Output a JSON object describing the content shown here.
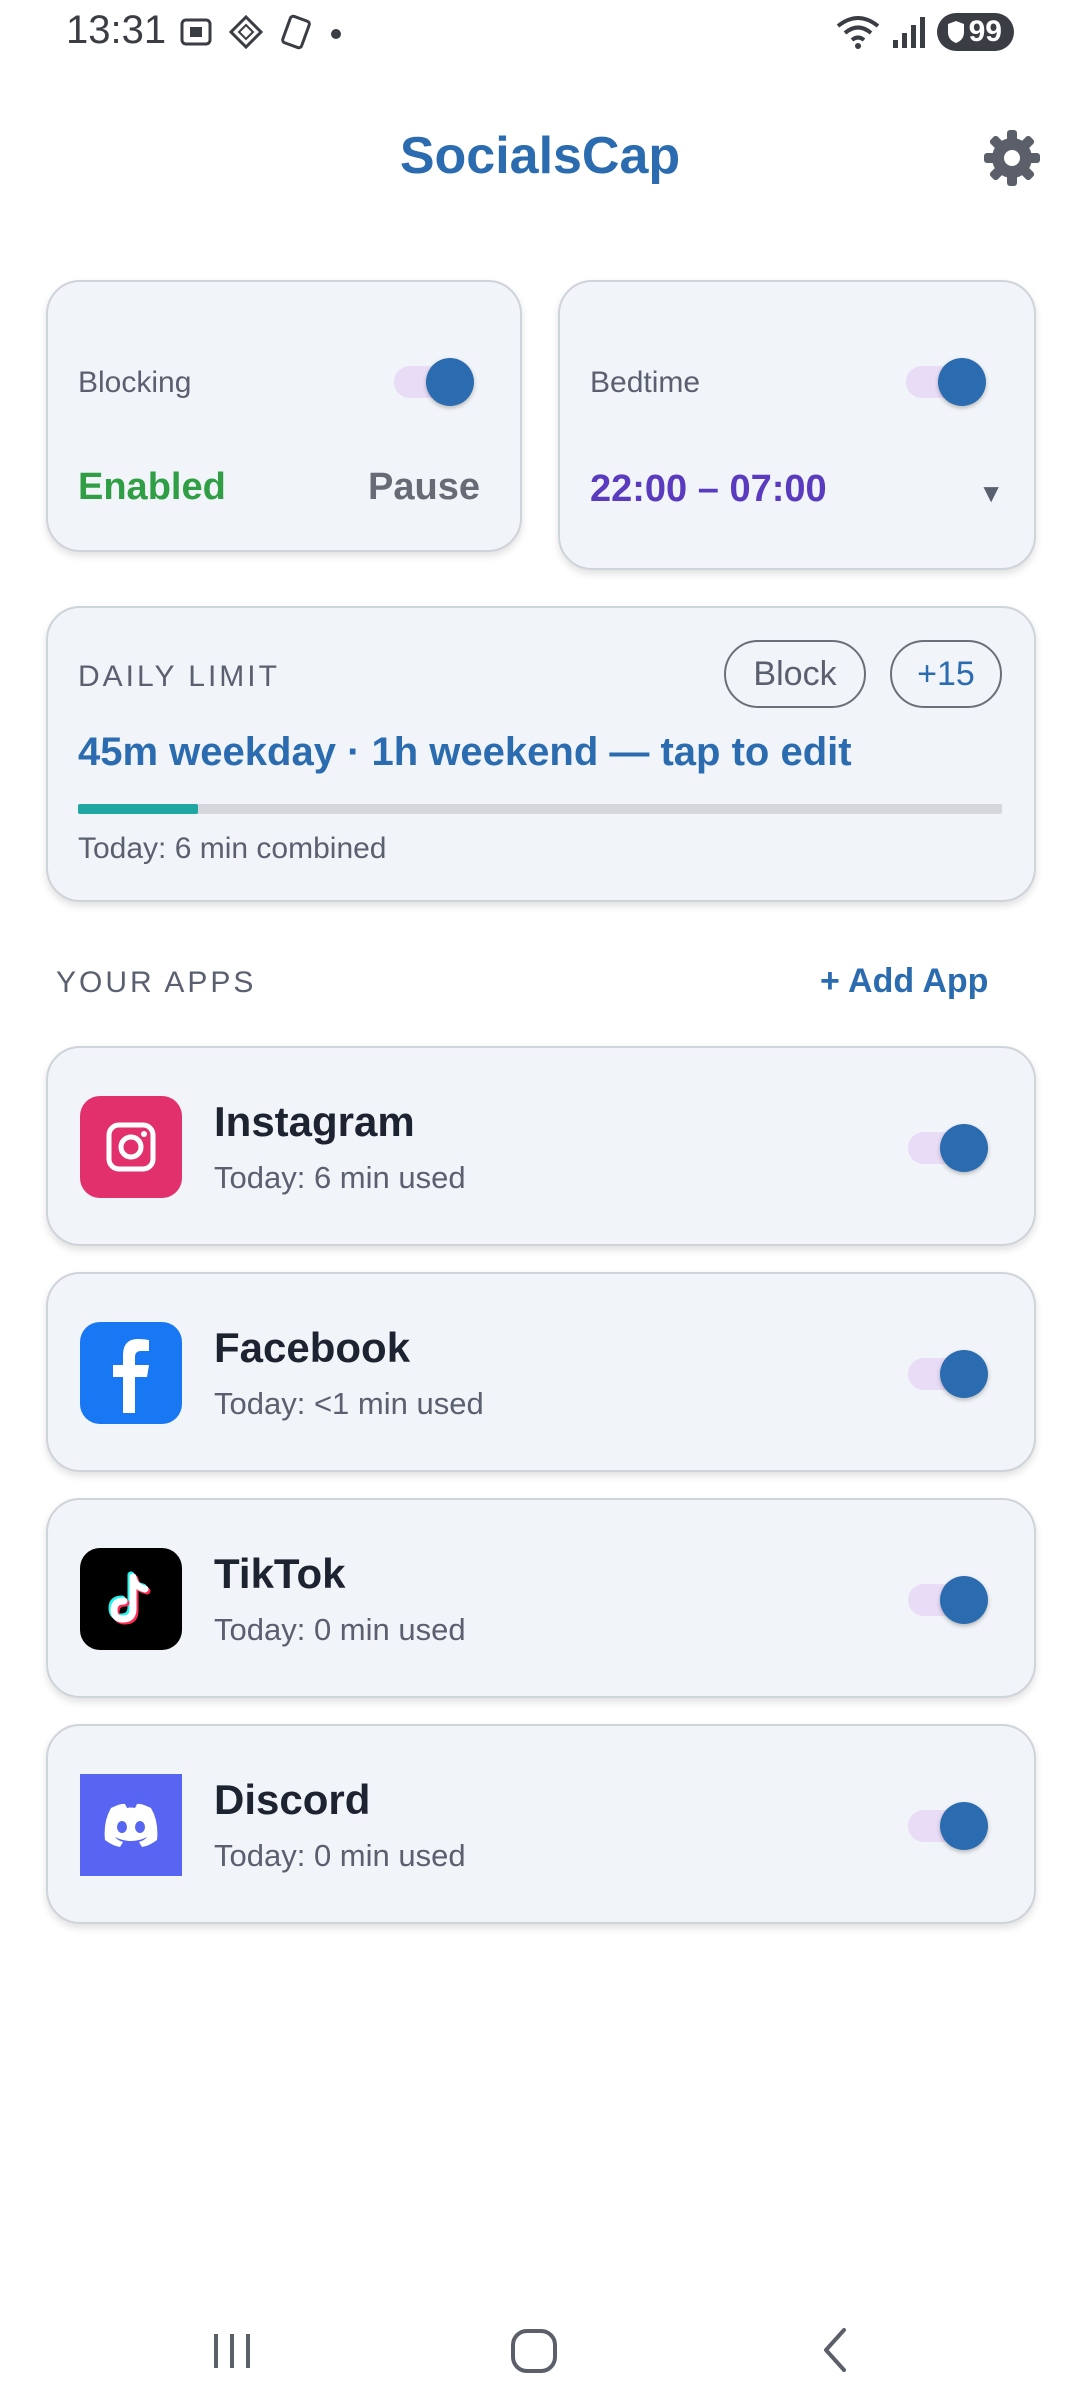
{
  "status_bar": {
    "time": "13:31",
    "battery": "99"
  },
  "header": {
    "title": "SocialsCap"
  },
  "blocking_card": {
    "label": "Blocking",
    "status": "Enabled",
    "pause_label": "Pause",
    "toggle_on": true
  },
  "bedtime_card": {
    "label": "Bedtime",
    "value": "22:00 – 07:00",
    "dropdown_symbol": "▼",
    "toggle_on": true
  },
  "daily_limit": {
    "label": "DAILY LIMIT",
    "block_label": "Block",
    "plus_label": "+15",
    "limit_text": "45m weekday · 1h weekend — tap to edit",
    "today_text": "Today: 6 min combined",
    "progress_fraction": 0.13
  },
  "apps_section": {
    "label": "YOUR APPS",
    "add_label": "+ Add App",
    "apps": [
      {
        "name": "Instagram",
        "usage": "Today: 6 min used",
        "icon": "instagram-icon",
        "color": "#e1306c",
        "enabled": true
      },
      {
        "name": "Facebook",
        "usage": "Today: <1 min used",
        "icon": "facebook-icon",
        "color": "#1877f2",
        "enabled": true
      },
      {
        "name": "TikTok",
        "usage": "Today: 0 min used",
        "icon": "tiktok-icon",
        "color": "#000000",
        "enabled": true
      },
      {
        "name": "Discord",
        "usage": "Today: 0 min used",
        "icon": "discord-icon",
        "color": "#5865f2",
        "enabled": true
      }
    ]
  },
  "colors": {
    "accent": "#2b6cb0",
    "enabled_green": "#2f9e44",
    "bedtime_purple": "#5a3bbf",
    "progress_teal": "#20a7a4"
  }
}
